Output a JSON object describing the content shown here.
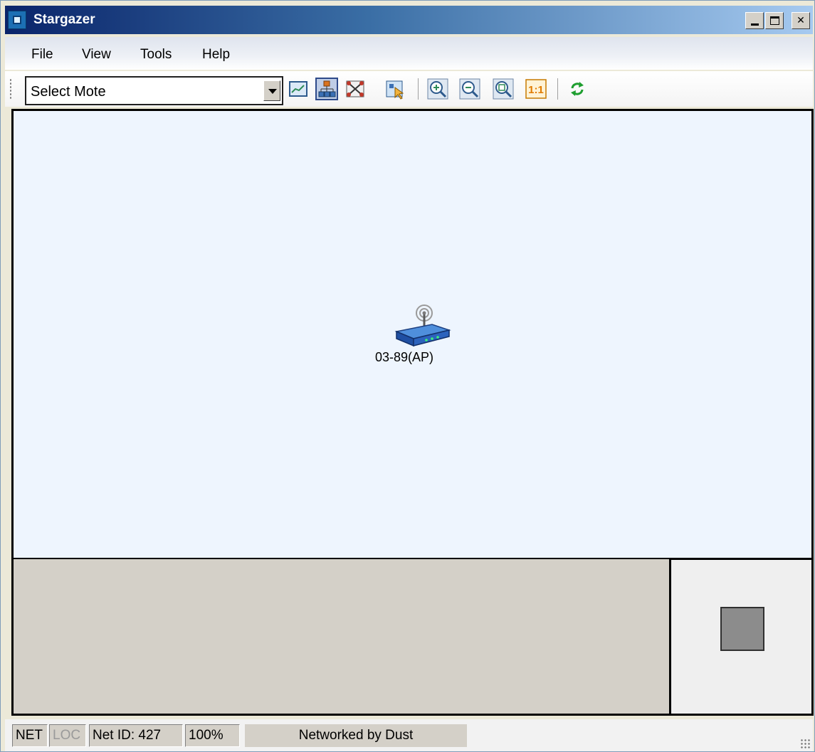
{
  "window": {
    "title": "Stargazer",
    "icon": "stargazer-app-icon"
  },
  "menu": {
    "items": [
      {
        "label": "File"
      },
      {
        "label": "View"
      },
      {
        "label": "Tools"
      },
      {
        "label": "Help"
      }
    ]
  },
  "toolbar": {
    "mote_select": {
      "value": "Select Mote"
    },
    "buttons": [
      {
        "icon": "chart-view-icon"
      },
      {
        "icon": "hierarchy-view-icon",
        "active": true
      },
      {
        "icon": "mesh-view-icon"
      },
      {
        "icon": "select-tool-icon"
      },
      {
        "icon": "zoom-in-icon"
      },
      {
        "icon": "zoom-out-icon"
      },
      {
        "icon": "zoom-fit-icon"
      },
      {
        "icon": "actual-size-icon",
        "text": "1:1"
      },
      {
        "icon": "refresh-icon"
      }
    ]
  },
  "canvas": {
    "node": {
      "label": "03-89(AP)",
      "icon": "access-point-router-icon"
    }
  },
  "status": {
    "net": "NET",
    "loc": "LOC",
    "net_id": "Net ID: 427",
    "zoom": "100%",
    "message": "Networked by Dust"
  },
  "colors": {
    "canvas_bg": "#eef5fe",
    "titlebar_start": "#0a246a",
    "titlebar_end": "#a6caf0",
    "panel_bg": "#d4d0c8"
  }
}
